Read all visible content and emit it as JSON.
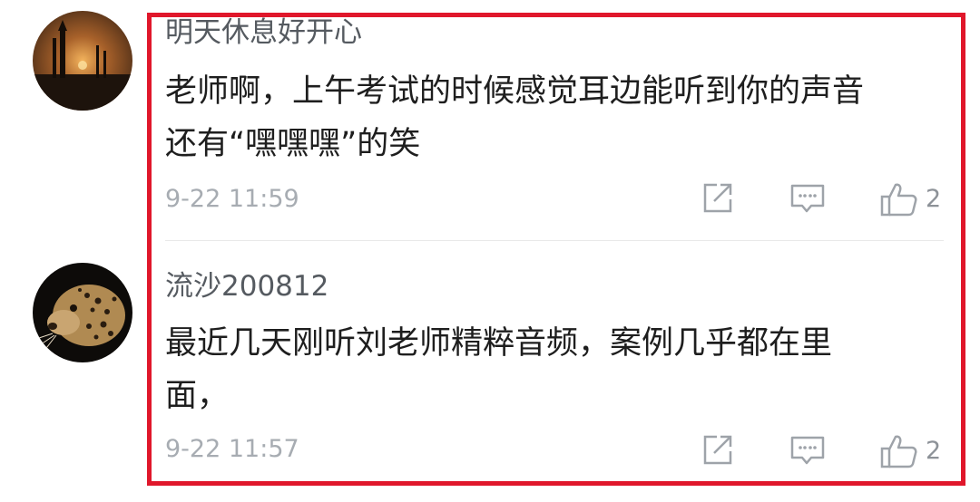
{
  "comments": [
    {
      "username": "明天休息好开心",
      "content_lines": [
        "老师啊，上午考试的时候感觉耳边能听到你的声音",
        "还有“嘿嘿嘿”的笑"
      ],
      "time": "9-22 11:59",
      "like_count": "2",
      "avatar_icon": "sunset-silhouette-avatar"
    },
    {
      "username": "流沙200812",
      "content_lines": [
        "最近几天刚听刘老师精粹音频，案例几乎都在里",
        "面，"
      ],
      "time": "9-22 11:57",
      "like_count": "2",
      "avatar_icon": "leopard-avatar"
    }
  ],
  "actions": {
    "share_icon": "share-icon",
    "reply_icon": "comment-icon",
    "like_icon": "thumbs-up-icon"
  },
  "colors": {
    "highlight_border": "#e0172b",
    "username": "#555a60",
    "content": "#1e1e1e",
    "meta": "#a7acb2",
    "icon": "#9ea3a9"
  }
}
